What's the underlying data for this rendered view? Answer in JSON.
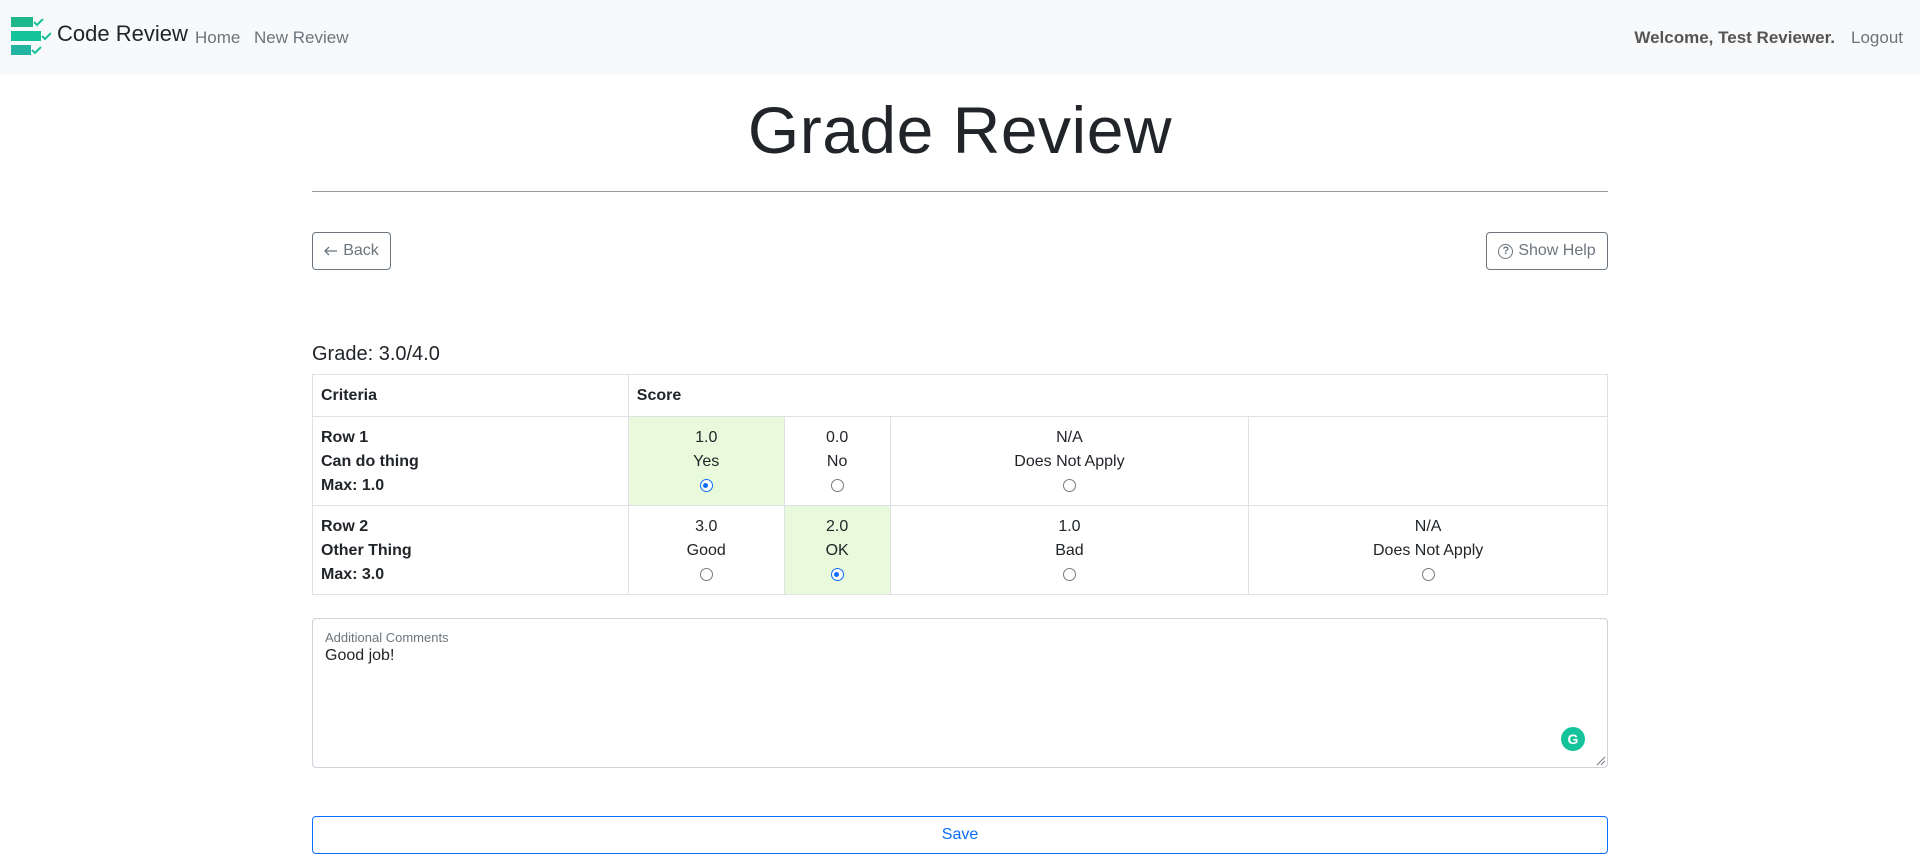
{
  "navbar": {
    "brand": "Code Review",
    "links": [
      "Home",
      "New Review"
    ],
    "welcome": "Welcome, Test Reviewer.",
    "logout": "Logout",
    "logo_color": "#15c39a"
  },
  "page": {
    "title": "Grade Review",
    "back_label": "Back",
    "back_icon": "arrow-left-icon",
    "help_label": "Show Help",
    "help_icon": "question-circle-icon"
  },
  "grade": {
    "label": "Grade: 3.0/4.0"
  },
  "rubric": {
    "headers": [
      "Criteria",
      "Score"
    ],
    "rows": [
      {
        "title": "Row 1",
        "description": "Can do thing",
        "max": "Max: 1.0",
        "options": [
          {
            "score": "1.0",
            "label": "Yes",
            "selected": true
          },
          {
            "score": "0.0",
            "label": "No",
            "selected": false
          },
          {
            "score": "N/A",
            "label": "Does Not Apply",
            "selected": false
          }
        ]
      },
      {
        "title": "Row 2",
        "description": "Other Thing",
        "max": "Max: 3.0",
        "options": [
          {
            "score": "3.0",
            "label": "Good",
            "selected": false
          },
          {
            "score": "2.0",
            "label": "OK",
            "selected": true
          },
          {
            "score": "1.0",
            "label": "Bad",
            "selected": false
          },
          {
            "score": "N/A",
            "label": "Does Not Apply",
            "selected": false
          }
        ]
      }
    ],
    "selected_color": "#e8fadb"
  },
  "comments": {
    "label": "Additional Comments",
    "value": "Good job!"
  },
  "actions": {
    "save_label": "Save",
    "accent_color": "#0d6efd"
  }
}
